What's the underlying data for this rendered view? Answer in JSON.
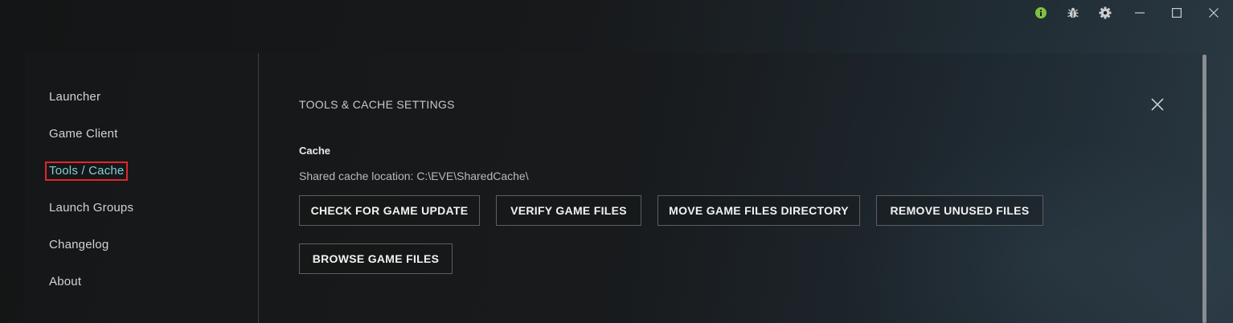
{
  "titlebar": {
    "icons": [
      "info-icon",
      "bug-icon",
      "gear-icon",
      "minimize-icon",
      "maximize-icon",
      "close-icon"
    ],
    "info_color": "#7fc241"
  },
  "sidebar": {
    "items": [
      {
        "label": "Launcher"
      },
      {
        "label": "Game Client"
      },
      {
        "label": "Tools / Cache",
        "active": true
      },
      {
        "label": "Launch Groups"
      },
      {
        "label": "Changelog"
      },
      {
        "label": "About"
      }
    ]
  },
  "main": {
    "title": "TOOLS & CACHE SETTINGS",
    "section": "Cache",
    "cache_location": "Shared cache location: C:\\EVE\\SharedCache\\",
    "buttons": [
      {
        "label": "CHECK FOR GAME UPDATE"
      },
      {
        "label": "VERIFY GAME FILES"
      },
      {
        "label": "MOVE GAME FILES DIRECTORY"
      },
      {
        "label": "REMOVE UNUSED FILES"
      },
      {
        "label": "BROWSE GAME FILES"
      }
    ]
  },
  "colors": {
    "accent_active": "#7fd0d8",
    "highlight_outline": "#e0262e"
  }
}
